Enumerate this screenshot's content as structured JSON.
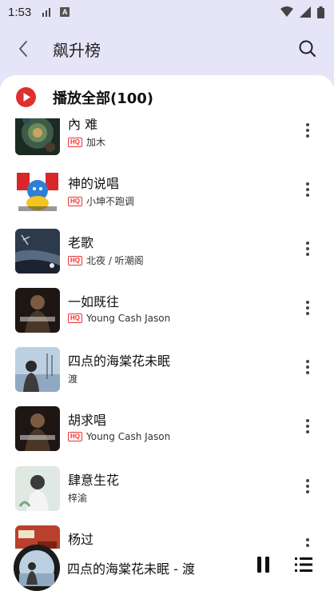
{
  "status_bar": {
    "time": "1:53"
  },
  "header": {
    "title": "飙升榜"
  },
  "play_all": {
    "label": "播放全部(100)"
  },
  "songs": [
    {
      "title": "內 难",
      "artist": "加木",
      "hq": true,
      "hq_label": "HQ"
    },
    {
      "title": "神的说唱",
      "artist": "小坤不跑调",
      "hq": true,
      "hq_label": "HQ"
    },
    {
      "title": "老歌",
      "artist": "北夜 / 听潮阁",
      "hq": true,
      "hq_label": "HQ"
    },
    {
      "title": "一如既往",
      "artist": "Young Cash Jason",
      "hq": true,
      "hq_label": "HQ"
    },
    {
      "title": "四点的海棠花未眠",
      "artist": "渡",
      "hq": false,
      "hq_label": ""
    },
    {
      "title": "胡求唱",
      "artist": "Young Cash Jason",
      "hq": true,
      "hq_label": "HQ"
    },
    {
      "title": "肆意生花",
      "artist": "梓渝",
      "hq": false,
      "hq_label": ""
    },
    {
      "title": "杨过",
      "artist": "",
      "hq": false,
      "hq_label": ""
    }
  ],
  "mini_player": {
    "now_playing": "四点的海棠花未眠 - 渡"
  },
  "colors": {
    "accent_red": "#e02f2f",
    "header_bg": "#e6e4f7"
  }
}
